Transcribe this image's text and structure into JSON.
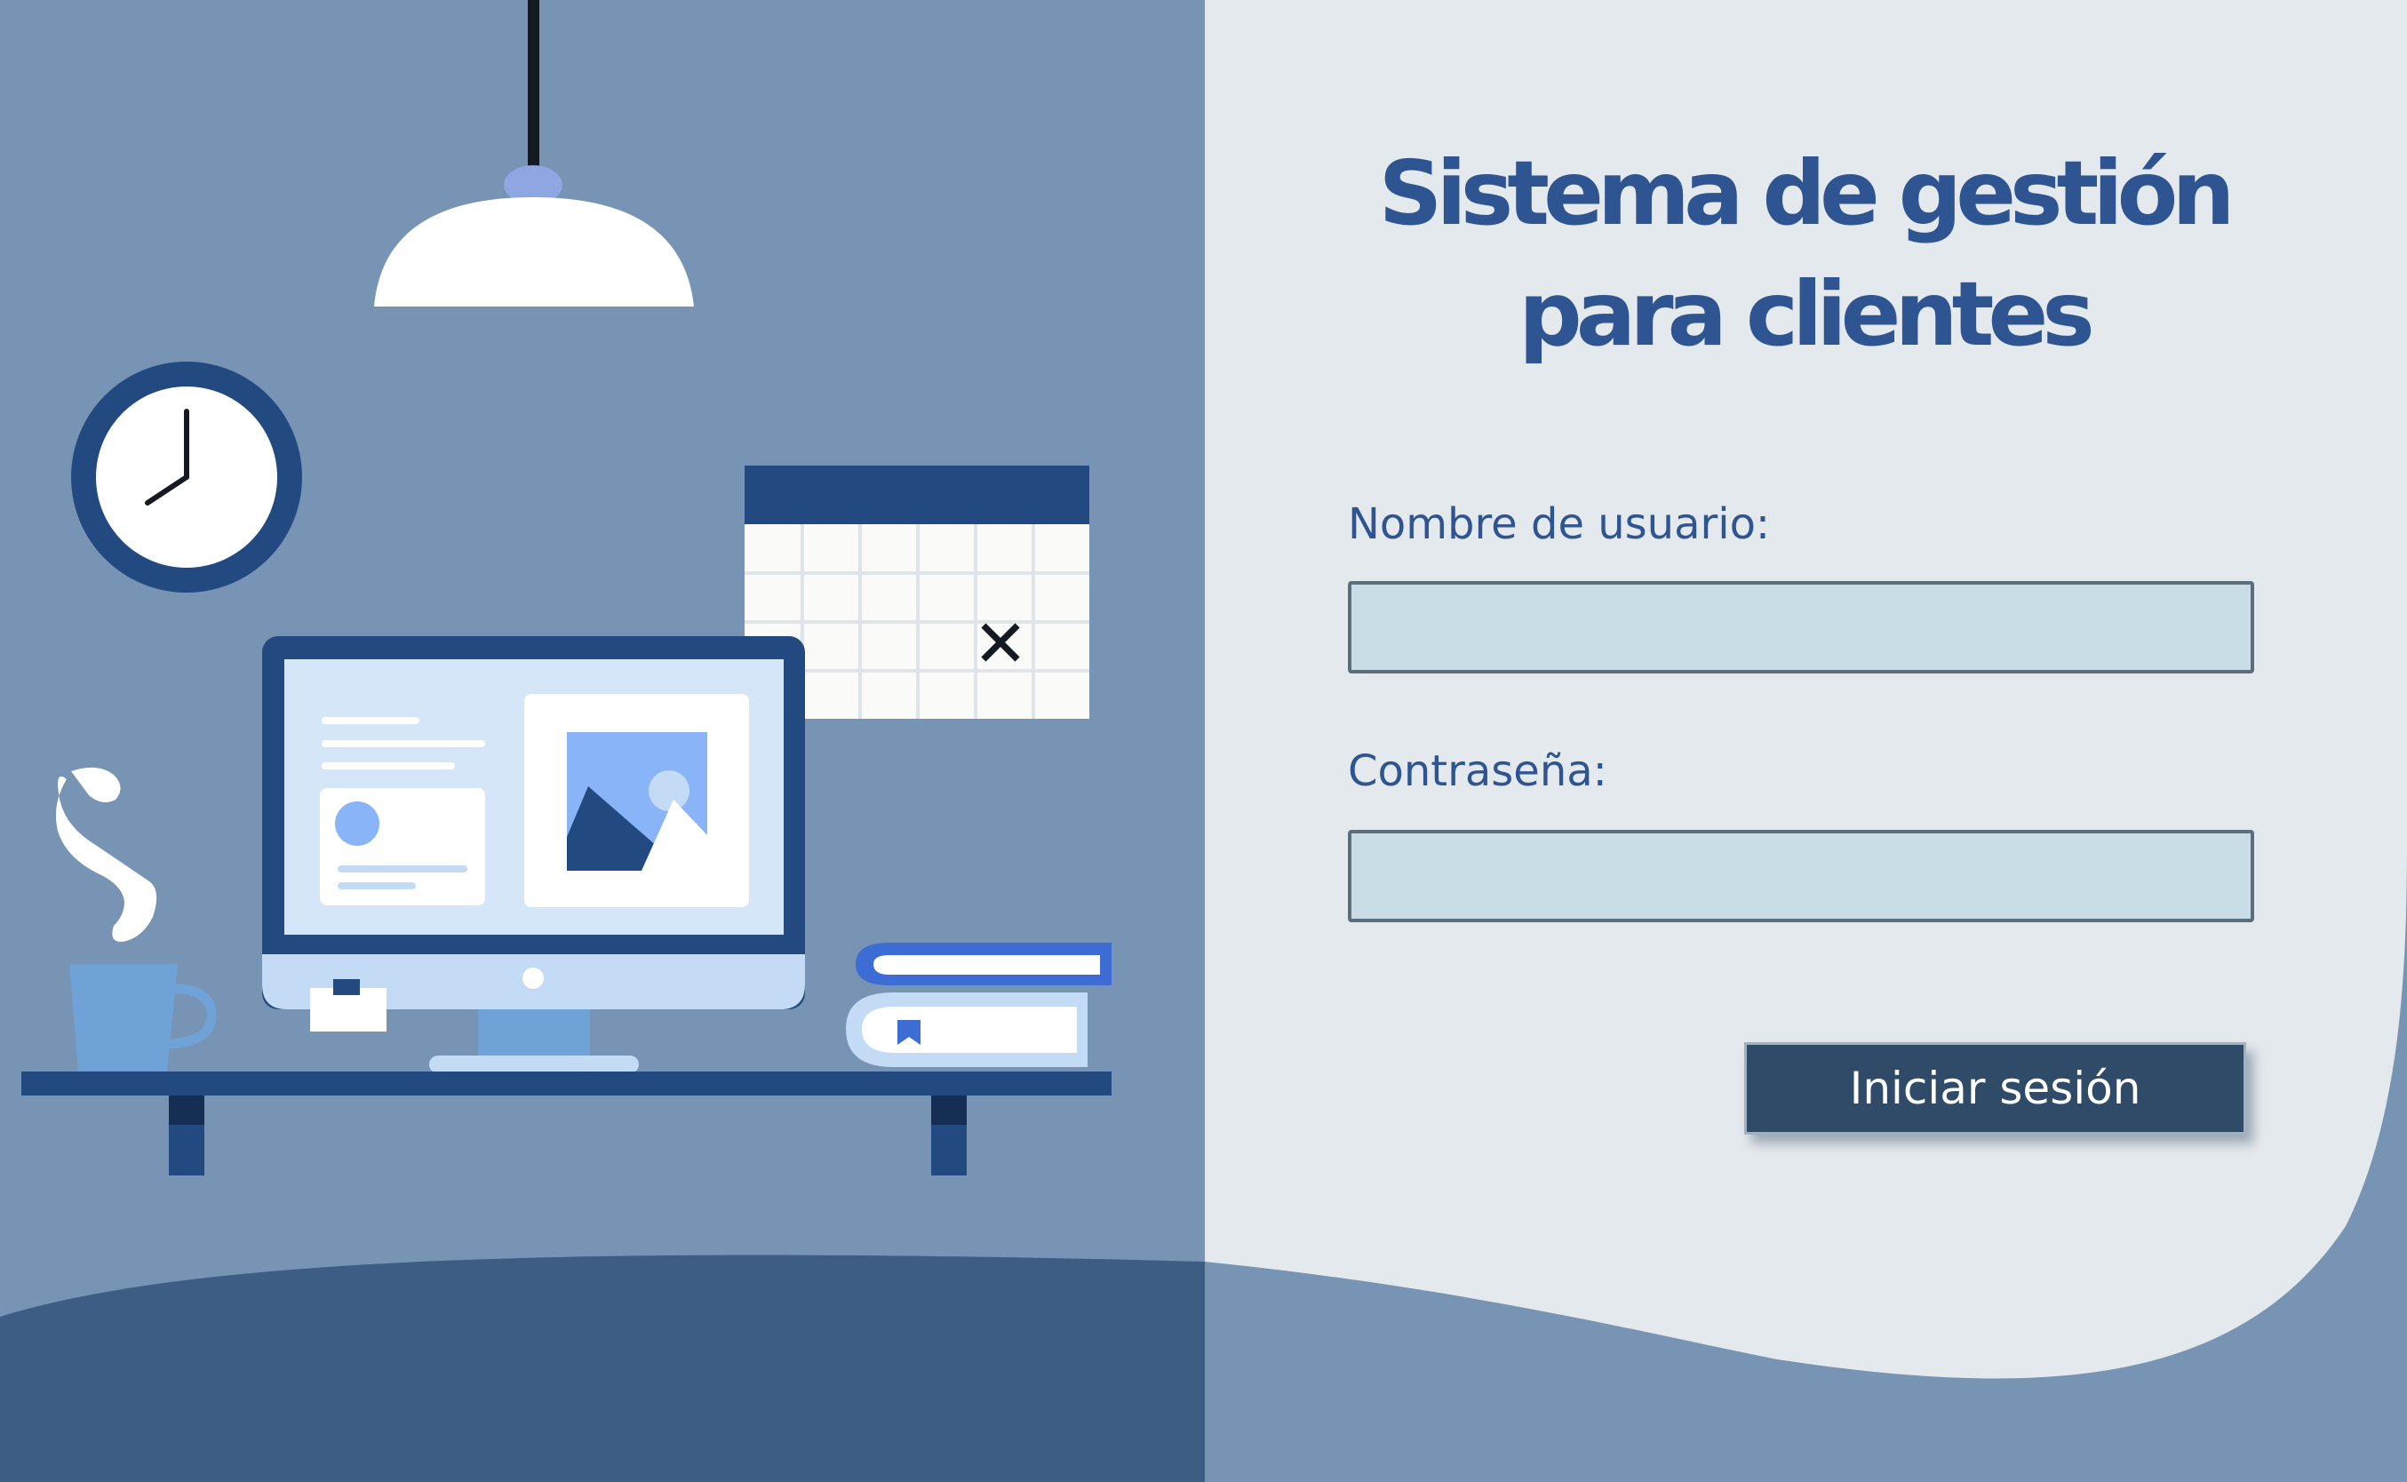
{
  "form": {
    "title_line1": "Sistema de gestión",
    "title_line2": "para clientes",
    "username_label": "Nombre de usuario:",
    "username_value": "",
    "username_placeholder": "",
    "password_label": "Contraseña:",
    "password_value": "",
    "password_placeholder": "",
    "submit_label": "Iniciar sesión"
  },
  "illustration": {
    "icons": [
      "pendant-lamp-icon",
      "wall-clock-icon",
      "wall-calendar-icon",
      "desktop-monitor-icon",
      "coffee-cup-icon",
      "book-stack-icon",
      "desk-shelf-icon"
    ],
    "calendar_marked_day_symbol": "✕"
  },
  "colors": {
    "left_panel": "#7794b4",
    "right_panel": "#e4e9ed",
    "floor": "#3d5d85",
    "wave": "#7794b4",
    "brand_blue": "#2e5591",
    "dark_navy": "#224a80",
    "input_fill": "#c9dde6",
    "input_border": "#5c6e7c",
    "button_fill": "#2f4b68",
    "button_text": "#ffffff"
  }
}
